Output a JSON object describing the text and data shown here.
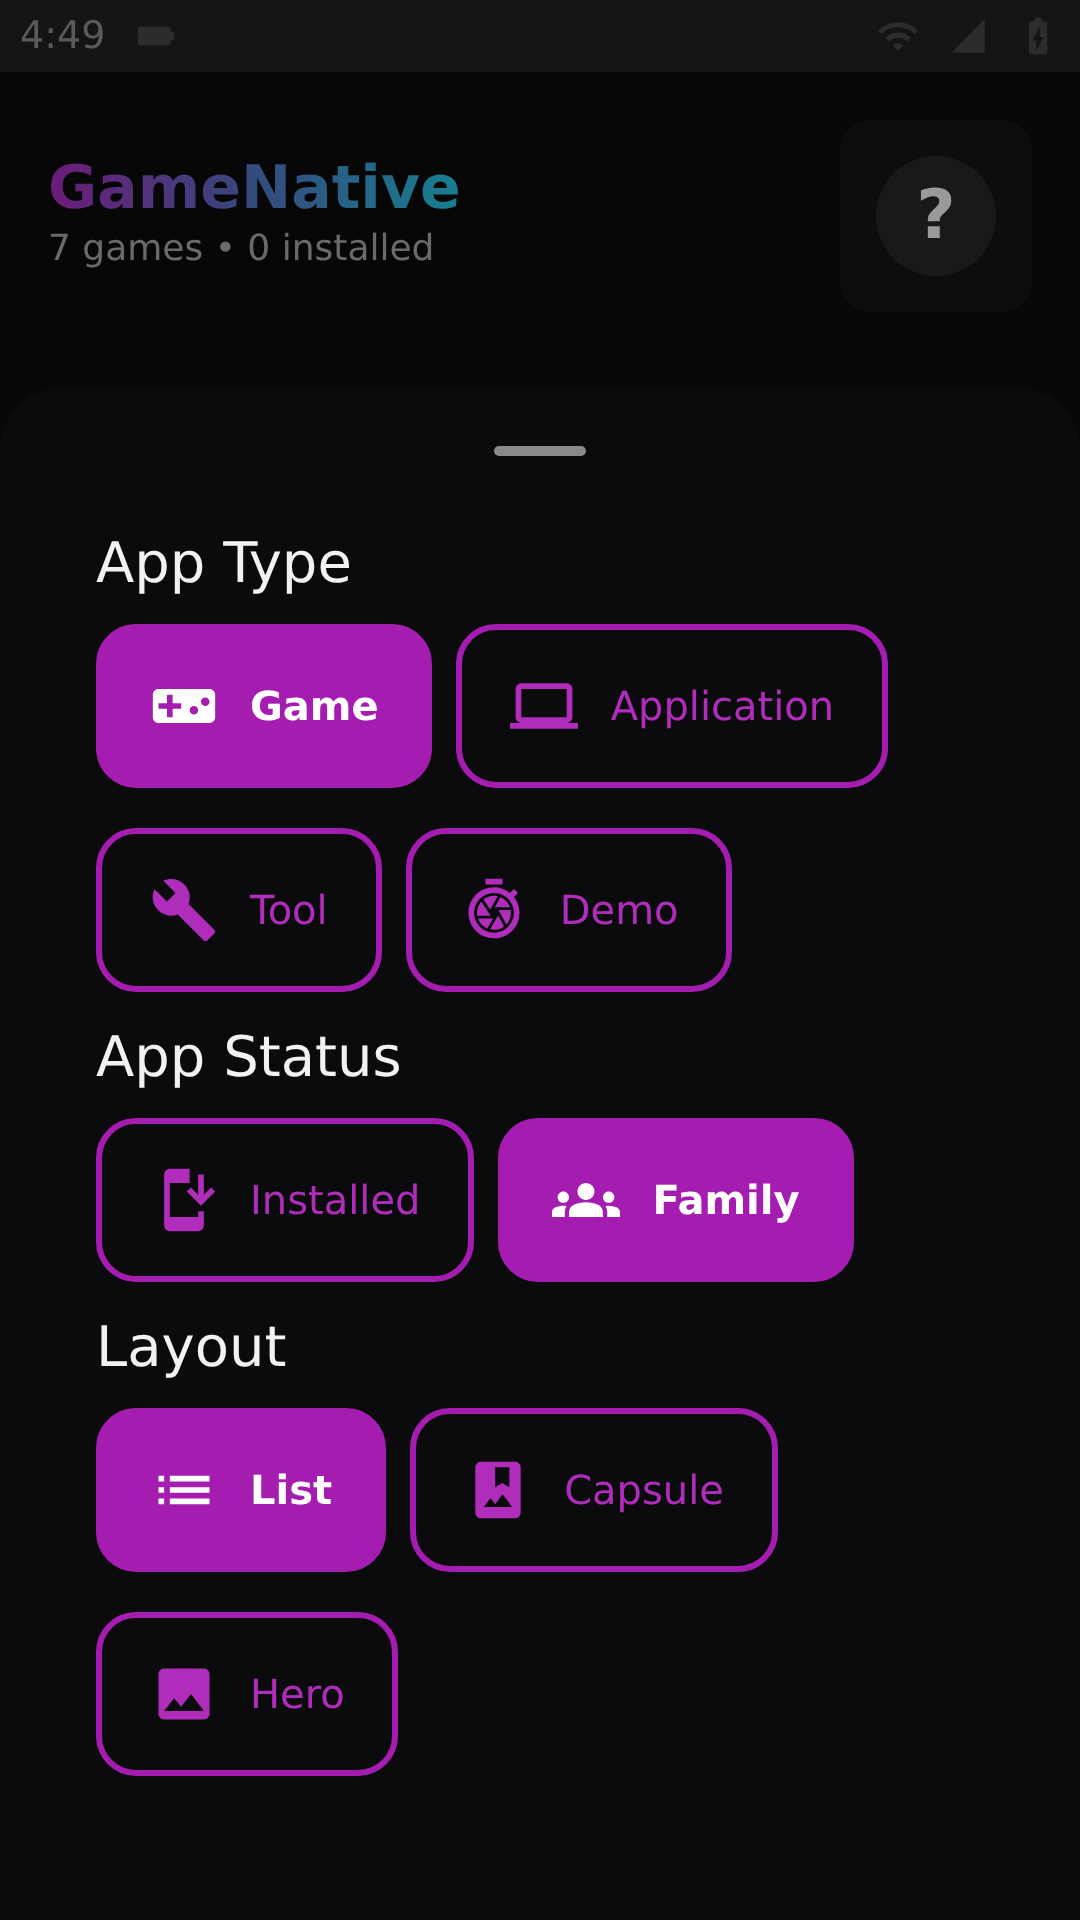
{
  "status_bar": {
    "time": "4:49"
  },
  "header": {
    "title": "GameNative",
    "subtitle": "7 games • 0 installed",
    "help_label": "?"
  },
  "sheet": {
    "sections": [
      {
        "title": "App Type",
        "chips": [
          {
            "label": "Game",
            "kind": "game",
            "selected": true
          },
          {
            "label": "Application",
            "kind": "application",
            "selected": false
          },
          {
            "label": "Tool",
            "kind": "tool",
            "selected": false
          },
          {
            "label": "Demo",
            "kind": "demo",
            "selected": false
          }
        ]
      },
      {
        "title": "App Status",
        "chips": [
          {
            "label": "Installed",
            "kind": "installed",
            "selected": false
          },
          {
            "label": "Family",
            "kind": "family",
            "selected": true
          }
        ]
      },
      {
        "title": "Layout",
        "chips": [
          {
            "label": "List",
            "kind": "list",
            "selected": true
          },
          {
            "label": "Capsule",
            "kind": "capsule",
            "selected": false
          },
          {
            "label": "Hero",
            "kind": "hero",
            "selected": false
          }
        ]
      }
    ]
  }
}
